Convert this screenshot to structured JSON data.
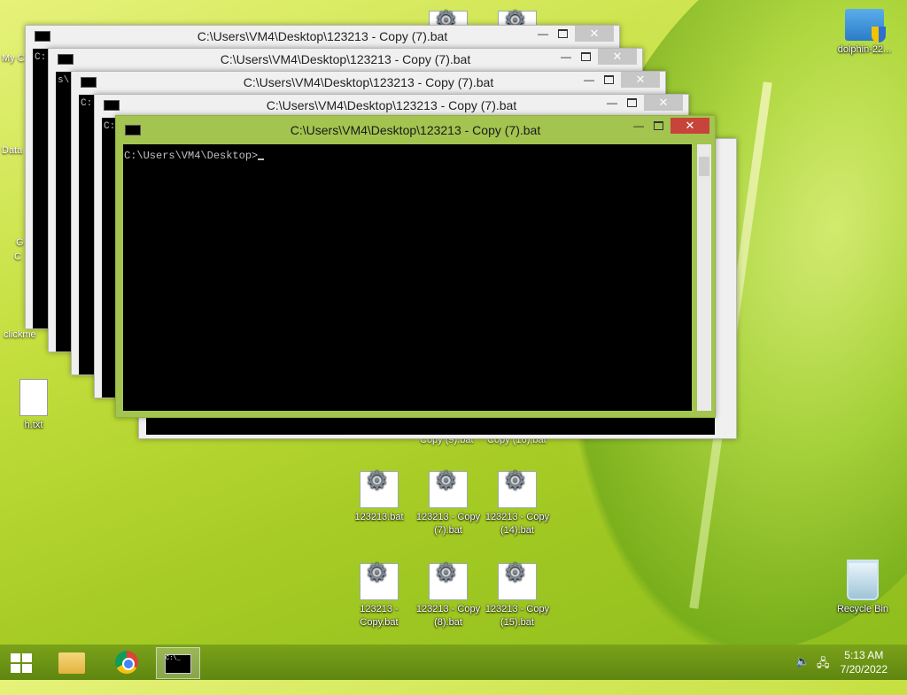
{
  "desktop": {
    "left_icon_labels": [
      "My C",
      "Data",
      "G",
      "C",
      "clickme",
      "h.txt"
    ],
    "icons": [
      {
        "label": "dolphin-22..."
      },
      {
        "label": "123213.bat"
      },
      {
        "label": "123213 - Copy (7).bat"
      },
      {
        "label": "123213 - Copy (14).bat"
      },
      {
        "label": "123213 - Copy.bat"
      },
      {
        "label": "123213 - Copy (8).bat"
      },
      {
        "label": "123213 - Copy (15).bat"
      },
      {
        "label": "Recycle Bin"
      }
    ],
    "partial_labels": [
      "Copy (9).bat",
      "Copy (16).bat"
    ]
  },
  "windows": {
    "title": "C:\\Users\\VM4\\Desktop\\123213 - Copy (7).bat",
    "prompt": "C:\\Users\\VM4\\Desktop>",
    "back_partial_lines": [
      "C:",
      "s\\",
      "C:"
    ],
    "close_glyph": "✕",
    "min_glyph": "—"
  },
  "taskbar": {
    "items": [
      {
        "icon": "windows-start-icon"
      },
      {
        "icon": "file-explorer-icon"
      },
      {
        "icon": "chrome-icon"
      },
      {
        "icon": "cmd-icon",
        "glyph_text": "C:\\_"
      }
    ],
    "clock_time": "5:13 AM",
    "clock_date": "7/20/2022",
    "tray_icons": [
      "speaker-muted-icon",
      "network-icon"
    ]
  },
  "colors": {
    "active_frame": "#a3c44f",
    "close_active": "#c7443a",
    "taskbar": "#6b9414"
  }
}
